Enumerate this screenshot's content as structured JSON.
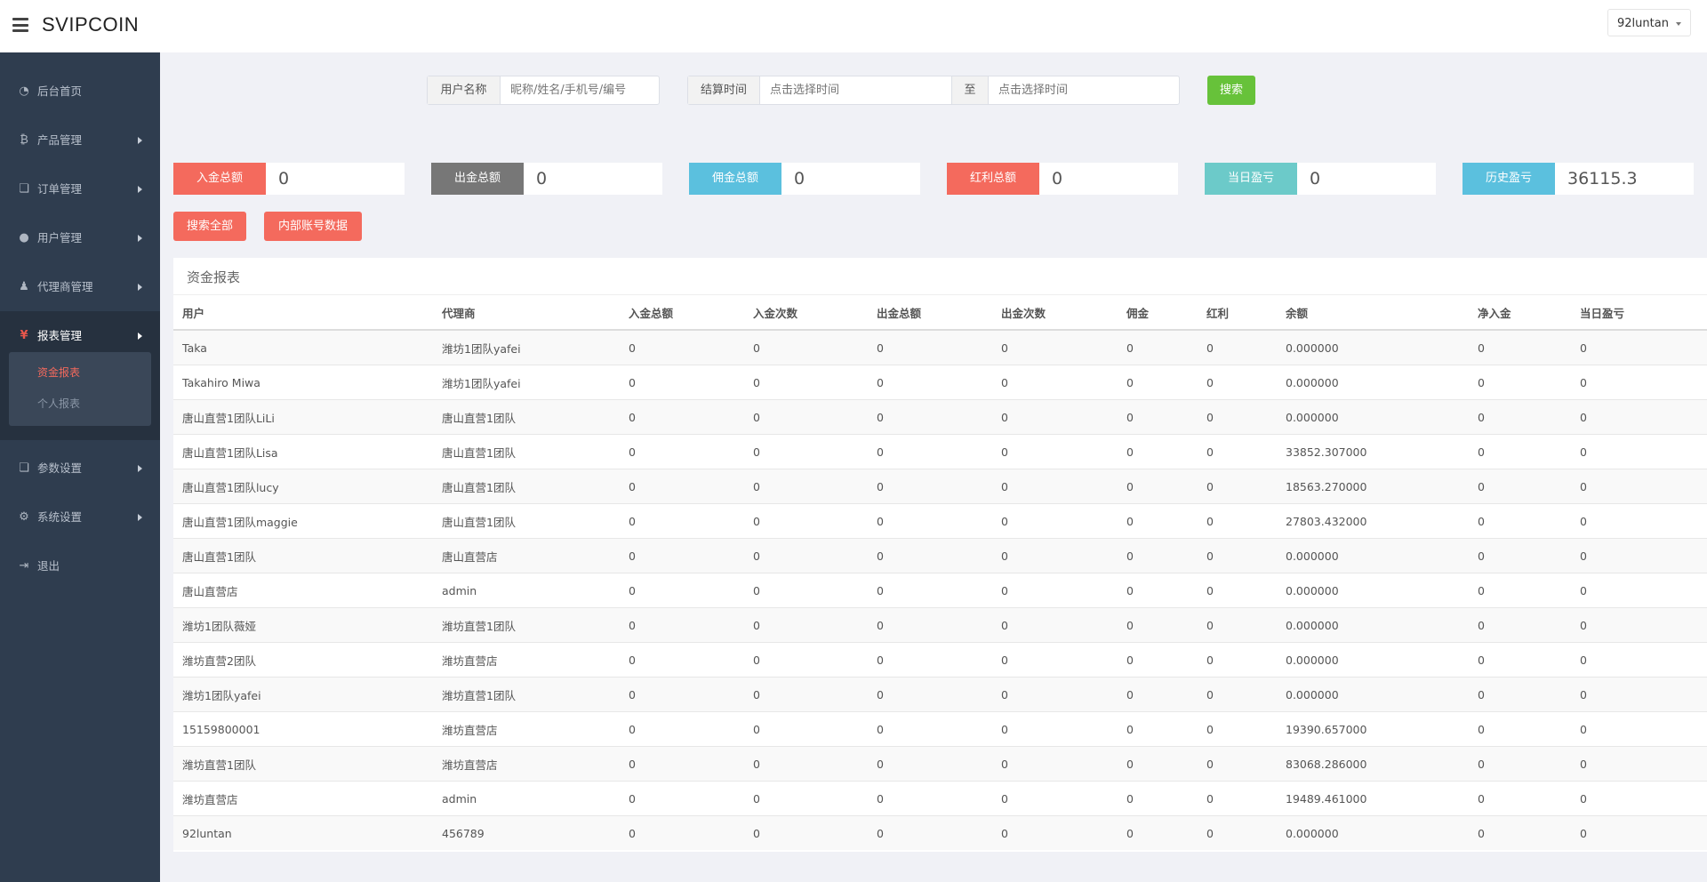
{
  "header": {
    "brand": "SVIPCOIN",
    "user": "92luntan"
  },
  "sidebar": {
    "items": [
      {
        "label": "后台首页",
        "icon": "dashboard-icon",
        "glyph": "◔"
      },
      {
        "label": "产品管理",
        "icon": "bitcoin-icon",
        "glyph": "₿"
      },
      {
        "label": "订单管理",
        "icon": "files-icon",
        "glyph": "❏"
      },
      {
        "label": "用户管理",
        "icon": "user-icon",
        "glyph": "●"
      },
      {
        "label": "代理商管理",
        "icon": "user-tie-icon",
        "glyph": "♟"
      },
      {
        "label": "报表管理",
        "icon": "yen-icon",
        "glyph": "¥"
      },
      {
        "label": "参数设置",
        "icon": "files-icon",
        "glyph": "❏"
      },
      {
        "label": "系统设置",
        "icon": "cogs-icon",
        "glyph": "⚙"
      },
      {
        "label": "退出",
        "icon": "sign-out-icon",
        "glyph": "⇥"
      }
    ],
    "subitems": [
      {
        "label": "资金报表"
      },
      {
        "label": "个人报表"
      }
    ]
  },
  "filters": {
    "username_label": "用户名称",
    "username_placeholder": "昵称/姓名/手机号/编号",
    "settle_label": "结算时间",
    "start_placeholder": "点击选择时间",
    "to_label": "至",
    "end_placeholder": "点击选择时间",
    "search_label": "搜索"
  },
  "stats": [
    {
      "label": "入金总额",
      "value": "0",
      "color": "#f46a5d"
    },
    {
      "label": "出金总额",
      "value": "0",
      "color": "#777777"
    },
    {
      "label": "佣金总额",
      "value": "0",
      "color": "#5bc0de"
    },
    {
      "label": "红利总额",
      "value": "0",
      "color": "#f46a5d"
    },
    {
      "label": "当日盈亏",
      "value": "0",
      "color": "#6ccac9"
    },
    {
      "label": "历史盈亏",
      "value": "36115.3",
      "color": "#5bc0de"
    }
  ],
  "actions": {
    "search_all": "搜索全部",
    "internal_data": "内部账号数据"
  },
  "report": {
    "title": "资金报表",
    "columns": [
      "用户",
      "代理商",
      "入金总额",
      "入金次数",
      "出金总额",
      "出金次数",
      "佣金",
      "红利",
      "余额",
      "净入金",
      "当日盈亏"
    ],
    "rows": [
      [
        "Taka",
        "潍坊1团队yafei",
        "0",
        "0",
        "0",
        "0",
        "0",
        "0",
        "0.000000",
        "0",
        "0"
      ],
      [
        "Takahiro Miwa",
        "潍坊1团队yafei",
        "0",
        "0",
        "0",
        "0",
        "0",
        "0",
        "0.000000",
        "0",
        "0"
      ],
      [
        "唐山直营1团队LiLi",
        "唐山直营1团队",
        "0",
        "0",
        "0",
        "0",
        "0",
        "0",
        "0.000000",
        "0",
        "0"
      ],
      [
        "唐山直营1团队Lisa",
        "唐山直营1团队",
        "0",
        "0",
        "0",
        "0",
        "0",
        "0",
        "33852.307000",
        "0",
        "0"
      ],
      [
        "唐山直营1团队lucy",
        "唐山直营1团队",
        "0",
        "0",
        "0",
        "0",
        "0",
        "0",
        "18563.270000",
        "0",
        "0"
      ],
      [
        "唐山直营1团队maggie",
        "唐山直营1团队",
        "0",
        "0",
        "0",
        "0",
        "0",
        "0",
        "27803.432000",
        "0",
        "0"
      ],
      [
        "唐山直营1团队",
        "唐山直营店",
        "0",
        "0",
        "0",
        "0",
        "0",
        "0",
        "0.000000",
        "0",
        "0"
      ],
      [
        "唐山直营店",
        "admin",
        "0",
        "0",
        "0",
        "0",
        "0",
        "0",
        "0.000000",
        "0",
        "0"
      ],
      [
        "潍坊1团队薇娅",
        "潍坊直营1团队",
        "0",
        "0",
        "0",
        "0",
        "0",
        "0",
        "0.000000",
        "0",
        "0"
      ],
      [
        "潍坊直营2团队",
        "潍坊直营店",
        "0",
        "0",
        "0",
        "0",
        "0",
        "0",
        "0.000000",
        "0",
        "0"
      ],
      [
        "潍坊1团队yafei",
        "潍坊直营1团队",
        "0",
        "0",
        "0",
        "0",
        "0",
        "0",
        "0.000000",
        "0",
        "0"
      ],
      [
        "15159800001",
        "潍坊直营店",
        "0",
        "0",
        "0",
        "0",
        "0",
        "0",
        "19390.657000",
        "0",
        "0"
      ],
      [
        "潍坊直营1团队",
        "潍坊直营店",
        "0",
        "0",
        "0",
        "0",
        "0",
        "0",
        "83068.286000",
        "0",
        "0"
      ],
      [
        "潍坊直营店",
        "admin",
        "0",
        "0",
        "0",
        "0",
        "0",
        "0",
        "19489.461000",
        "0",
        "0"
      ],
      [
        "92luntan",
        "456789",
        "0",
        "0",
        "0",
        "0",
        "0",
        "0",
        "0.000000",
        "0",
        "0"
      ]
    ]
  }
}
